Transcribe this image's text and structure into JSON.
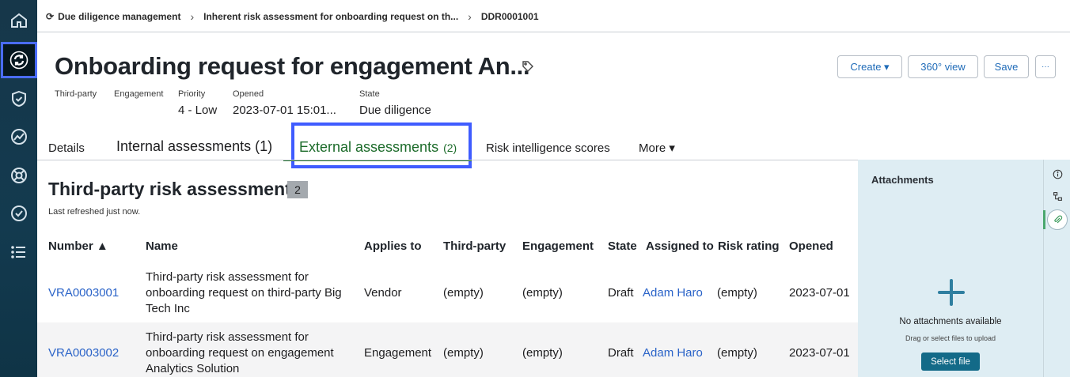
{
  "breadcrumbs": {
    "item1": "Due diligence management",
    "item2": "Inherent risk assessment for onboarding request on th...",
    "item3": "DDR0001001"
  },
  "header": {
    "title": "Onboarding request for engagement An...",
    "create_label": "Create ▾",
    "view360_label": "360° view",
    "save_label": "Save",
    "more_label": "···"
  },
  "fields": {
    "third_party_label": "Third-party",
    "engagement_label": "Engagement",
    "priority_label": "Priority",
    "priority_value": "4 - Low",
    "opened_label": "Opened",
    "opened_value": "2023-07-01 15:01...",
    "state_label": "State",
    "state_value": "Due diligence"
  },
  "tabs": {
    "details": "Details",
    "internal": "Internal assessments (1)",
    "external": "External assessments",
    "external_count": "(2)",
    "risk": "Risk intelligence scores",
    "more": "More ▾"
  },
  "section": {
    "title": "Third-party risk assessments",
    "count": "2",
    "refreshed": "Last refreshed just now."
  },
  "table": {
    "headers": {
      "number": "Number ▲",
      "name": "Name",
      "applies_to": "Applies to",
      "third_party": "Third-party",
      "engagement": "Engagement",
      "state": "State",
      "assigned_to": "Assigned to",
      "risk_rating": "Risk rating",
      "opened": "Opened"
    },
    "rows": [
      {
        "number": "VRA0003001",
        "name": "Third-party risk assessment for onboarding request on third-party Big Tech Inc",
        "applies_to": "Vendor",
        "third_party": "(empty)",
        "engagement": "(empty)",
        "state": "Draft",
        "assigned_to": "Adam Haro",
        "risk_rating": "(empty)",
        "opened": "2023-07-01"
      },
      {
        "number": "VRA0003002",
        "name": "Third-party risk assessment for onboarding request on engagement Analytics Solution",
        "applies_to": "Engagement",
        "third_party": "(empty)",
        "engagement": "(empty)",
        "state": "Draft",
        "assigned_to": "Adam Haro",
        "risk_rating": "(empty)",
        "opened": "2023-07-01"
      }
    ]
  },
  "attachments": {
    "title": "Attachments",
    "empty": "No attachments available",
    "hint": "Drag or select files to upload",
    "select_label": "Select file"
  },
  "colors": {
    "rail": "#16374a",
    "link": "#2a63c8",
    "active_tab": "#1c6b2a",
    "highlight": "#3f5cff",
    "attachment_bg": "#deedf3",
    "select_button": "#136a88"
  }
}
